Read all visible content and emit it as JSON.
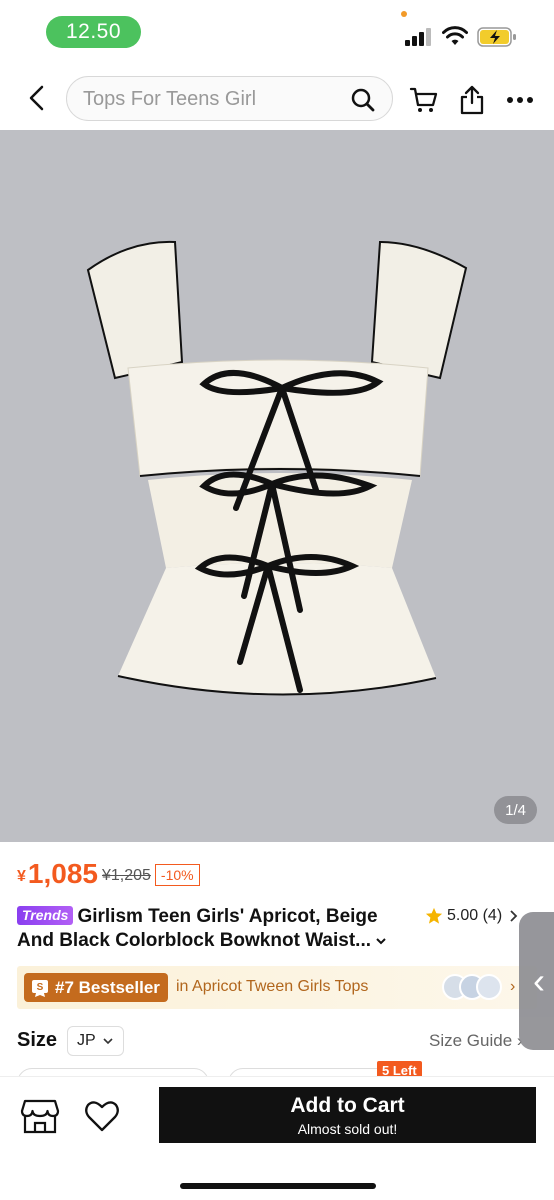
{
  "status_bar": {
    "time": "12.50"
  },
  "header": {
    "search_placeholder": "Tops For Teens Girl",
    "icons": [
      "back-chevron-icon",
      "search-icon",
      "cart-icon",
      "share-icon",
      "more-icon"
    ]
  },
  "gallery": {
    "counter": "1/4"
  },
  "price": {
    "currency": "¥",
    "current": "1,085",
    "original": "¥1,205",
    "discount": "-10%"
  },
  "product": {
    "badge": "Trends",
    "title_line1": "Girlism Teen Girls' Apricot, Beige",
    "title_line2": "And Black Colorblock Bowknot Waist...",
    "rating": "5.00",
    "rating_count": "(4)"
  },
  "bestseller": {
    "rank": "#7 Bestseller",
    "category": "in Apricot Tween Girls Tops"
  },
  "size": {
    "label": "Size",
    "region": "JP",
    "guide": "Size Guide",
    "stock_badge": "5 Left"
  },
  "bottom_bar": {
    "add_to_cart": "Add to Cart",
    "stock_note": "Almost sold out!"
  },
  "colors": {
    "accent": "#f35a1f",
    "cart_button": "#111111",
    "bestseller_text": "#b1661d",
    "bestseller_pill": "#c46b1e",
    "trends_badge": "#8a3ff0",
    "time_pill": "#4cc25e"
  }
}
